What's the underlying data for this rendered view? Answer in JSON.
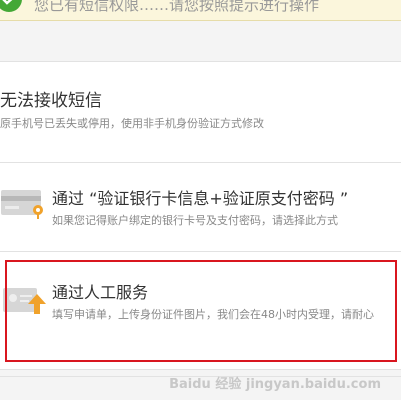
{
  "banner": {
    "message": "您已有短信权限……请您按照提示进行操作"
  },
  "options": [
    {
      "title": "无法接收短信",
      "desc": "原手机号已丢失或停用，使用非手机身份验证方式修改"
    },
    {
      "title": "通过 “验证银行卡信息+验证原支付密码 ”",
      "desc": "如果您记得账户绑定的银行卡号及支付密码，请选择此方式"
    },
    {
      "title": "通过人工服务",
      "desc": "填写申请单，上传身份证件图片，我们会在48小时内受理，请耐心"
    }
  ],
  "watermark": "Baidu 经验 jingyan.baidu.com",
  "colors": {
    "highlight": "#d9161f",
    "check": "#44a836",
    "upload_arrow": "#f0a22b"
  }
}
